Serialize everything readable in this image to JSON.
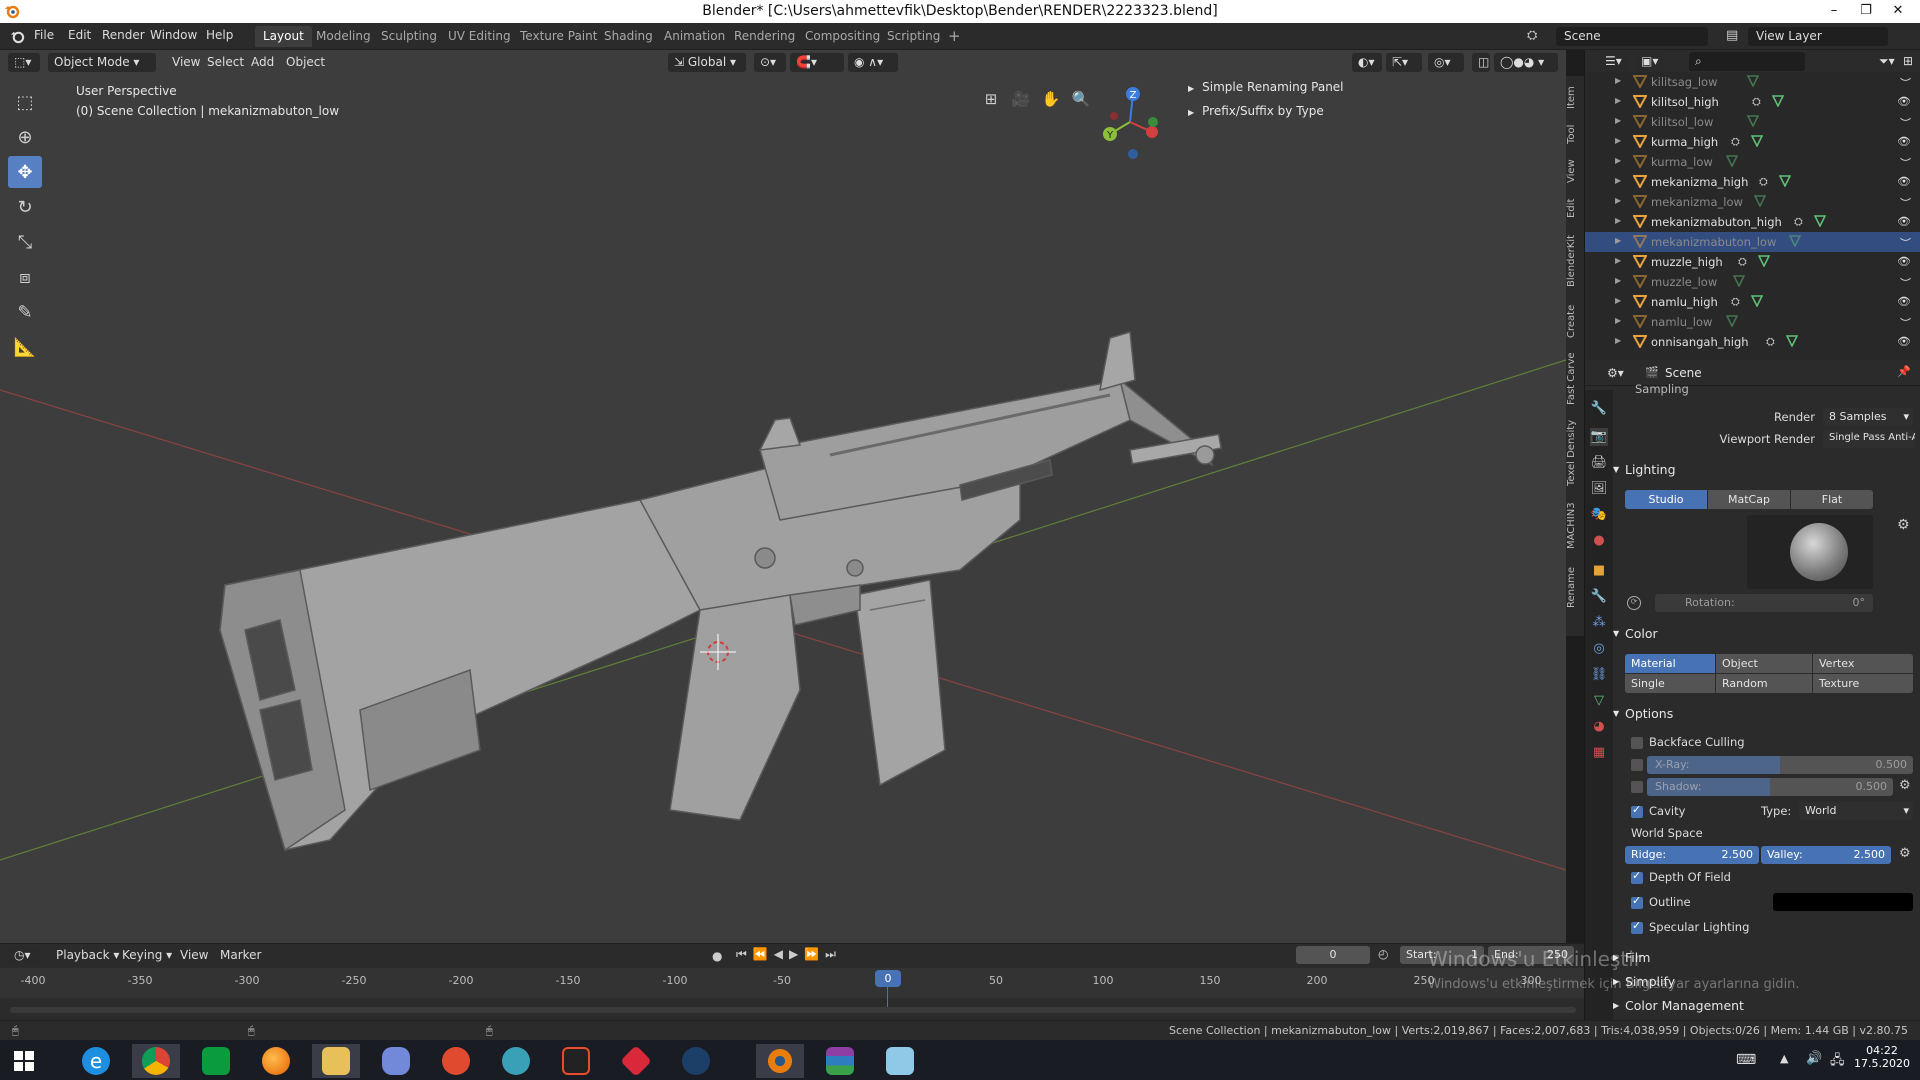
{
  "window": {
    "title": "Blender* [C:\\Users\\ahmettevfik\\Desktop\\Bender\\RENDER\\2223323.blend]",
    "minimize": "–",
    "restore": "❐",
    "close": "✕"
  },
  "menubar": {
    "items": [
      "File",
      "Edit",
      "Render",
      "Window",
      "Help"
    ],
    "workspaces": [
      "Layout",
      "Modeling",
      "Sculpting",
      "UV Editing",
      "Texture Paint",
      "Shading",
      "Animation",
      "Rendering",
      "Compositing",
      "Scripting"
    ],
    "active_workspace": "Layout",
    "add_tab": "+",
    "scene": "Scene",
    "view_layer": "View Layer"
  },
  "viewport": {
    "mode": "Object Mode",
    "menus": [
      "View",
      "Select",
      "Add",
      "Object"
    ],
    "orientation": "Global",
    "overlay_text_1": "User Perspective",
    "overlay_text_2": "(0) Scene Collection | mekanizmabuton_low",
    "panels": [
      "Simple Renaming Panel",
      "Prefix/Suffix by Type"
    ],
    "side_tabs": [
      "Item",
      "Tool",
      "View",
      "Edit",
      "BlenderKit",
      "Create",
      "Fast Carve",
      "Texel Density",
      "MACHIN3",
      "Rename"
    ],
    "gizmo_labels": [
      "Z",
      "Y",
      "X"
    ]
  },
  "outliner": {
    "rows": [
      {
        "name": "kilitsag_low",
        "dim": true,
        "modifier": false,
        "visible": false
      },
      {
        "name": "kilitsol_high",
        "dim": false,
        "modifier": true,
        "visible": true
      },
      {
        "name": "kilitsol_low",
        "dim": true,
        "modifier": false,
        "visible": false
      },
      {
        "name": "kurma_high",
        "dim": false,
        "modifier": true,
        "visible": true
      },
      {
        "name": "kurma_low",
        "dim": true,
        "modifier": false,
        "visible": false
      },
      {
        "name": "mekanizma_high",
        "dim": false,
        "modifier": true,
        "visible": true
      },
      {
        "name": "mekanizma_low",
        "dim": true,
        "modifier": false,
        "visible": false
      },
      {
        "name": "mekanizmabuton_high",
        "dim": false,
        "modifier": true,
        "visible": true
      },
      {
        "name": "mekanizmabuton_low",
        "dim": true,
        "modifier": false,
        "visible": false,
        "selected": true
      },
      {
        "name": "muzzle_high",
        "dim": false,
        "modifier": true,
        "visible": true
      },
      {
        "name": "muzzle_low",
        "dim": true,
        "modifier": false,
        "visible": false
      },
      {
        "name": "namlu_high",
        "dim": false,
        "modifier": true,
        "visible": true
      },
      {
        "name": "namlu_low",
        "dim": true,
        "modifier": false,
        "visible": false
      },
      {
        "name": "onnisangah_high",
        "dim": false,
        "modifier": true,
        "visible": true
      }
    ]
  },
  "properties": {
    "context": "Scene",
    "sampling_header": "Sampling",
    "render_label": "Render",
    "render_value": "8 Samples",
    "viewport_render_label": "Viewport Render",
    "viewport_render_value": "Single Pass Anti-Aliasing",
    "lighting": {
      "header": "Lighting",
      "modes": [
        "Studio",
        "MatCap",
        "Flat"
      ],
      "active": "Studio",
      "rotation_label": "Rotation:",
      "rotation_value": "0°"
    },
    "color": {
      "header": "Color",
      "row1": [
        "Material",
        "Object",
        "Vertex"
      ],
      "row2": [
        "Single",
        "Random",
        "Texture"
      ],
      "active": "Material"
    },
    "options": {
      "header": "Options",
      "backface_culling": "Backface Culling",
      "xray_label": "X-Ray:",
      "xray_value": "0.500",
      "xray_fraction": 0.5,
      "shadow_label": "Shadow:",
      "shadow_value": "0.500",
      "shadow_fraction": 0.5,
      "cavity": "Cavity",
      "type_label": "Type:",
      "type_value": "World",
      "world_space": "World Space",
      "ridge_label": "Ridge:",
      "ridge_value": "2.500",
      "valley_label": "Valley:",
      "valley_value": "2.500",
      "depth_of_field": "Depth Of Field",
      "outline": "Outline",
      "specular": "Specular Lighting"
    },
    "film": "Film",
    "simplify": "Simplify",
    "color_management": "Color Management"
  },
  "timeline": {
    "menus": [
      "Playback",
      "Keying",
      "View",
      "Marker"
    ],
    "current_frame": "0",
    "start_label": "Start:",
    "start_value": "1",
    "end_label": "End:",
    "end_value": "250",
    "ruler": [
      "-400",
      "-350",
      "-300",
      "-250",
      "-200",
      "-150",
      "-100",
      "-50",
      "0",
      "50",
      "100",
      "150",
      "200",
      "250",
      "300"
    ]
  },
  "watermark": {
    "line1": "Windows'u Etkinleştir",
    "line2": "Windows'u etkinleştirmek için Bilgisayar ayarlarına gidin."
  },
  "status": {
    "text": "Scene Collection | mekanizmabuton_low | Verts:2,019,867 | Faces:2,007,683 | Tris:4,038,959 | Objects:0/26 | Mem: 1.44 GB | v2.80.75"
  },
  "taskbar": {
    "apps": [
      "start",
      "internet-explorer",
      "chrome",
      "store",
      "firefox",
      "file-explorer",
      "discord",
      "headphones",
      "teamviewer",
      "flstudio",
      "substance",
      "steam",
      "blender",
      "winrar",
      "notepad"
    ],
    "time": "04:22",
    "date": "17.5.2020"
  },
  "colors": {
    "accent": "#4772b3",
    "selected_row": "#334d80",
    "mesh_icon": "#e8a23c",
    "data_icon": "#5fbf76"
  }
}
